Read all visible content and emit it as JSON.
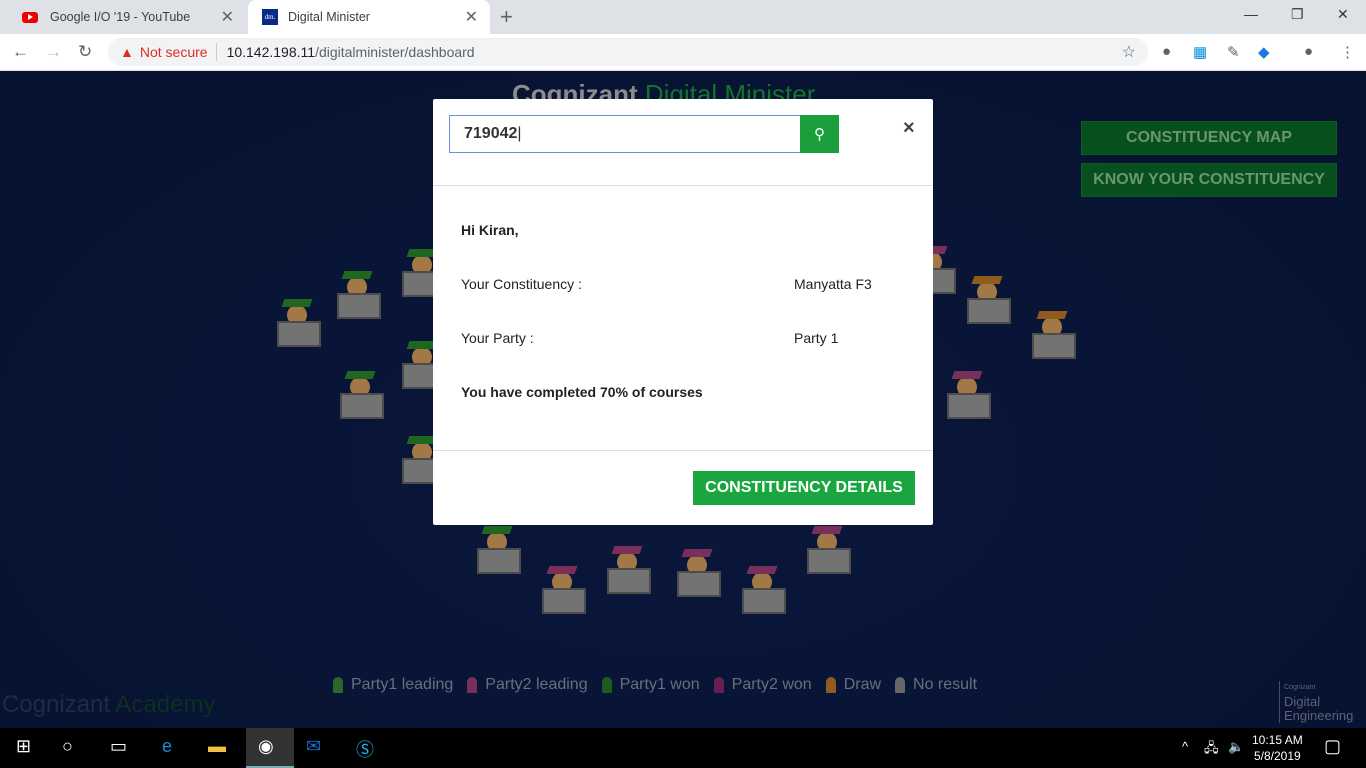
{
  "browser": {
    "tabs": [
      {
        "title": "Google I/O '19 - YouTube",
        "icon": "youtube-icon"
      },
      {
        "title": "Digital Minister",
        "icon": "dm-favicon",
        "favicon_text": "dm."
      }
    ],
    "security": "Not secure",
    "url_host": "10.142.198.11",
    "url_path": "/digitalminister/dashboard"
  },
  "page": {
    "logo_main": "Cognizant",
    "logo_sub": "Digital Minister",
    "buttons": [
      "CONSTITUENCY MAP",
      "KNOW YOUR CONSTITUENCY"
    ],
    "legend": [
      {
        "label": "Party1 leading",
        "color": "#3a8a3a"
      },
      {
        "label": "Party2 leading",
        "color": "#a0407a"
      },
      {
        "label": "Party1 won",
        "color": "#2a7a2a"
      },
      {
        "label": "Party2 won",
        "color": "#8a2a6a"
      },
      {
        "label": "Draw",
        "color": "#c07a2a"
      },
      {
        "label": "No result",
        "color": "#888888"
      }
    ],
    "academy_main": "Cognizant",
    "academy_sub": "Academy",
    "cde_small": "Cognizant",
    "cde_line1": "Digital",
    "cde_line2": "Engineering"
  },
  "modal": {
    "search_value": "719042",
    "greeting": "Hi Kiran,",
    "constituency_label": "Your Constituency :",
    "constituency_value": "Manyatta F3",
    "party_label": "Your Party :",
    "party_value": "Party 1",
    "progress_text": "You have completed 70% of courses",
    "progress_percent": 70,
    "details_button": "CONSTITUENCY DETAILS"
  },
  "taskbar": {
    "time": "10:15 AM",
    "date": "5/8/2019"
  },
  "colors": {
    "accent": "#1aa63e",
    "background": "#0b1a42"
  }
}
